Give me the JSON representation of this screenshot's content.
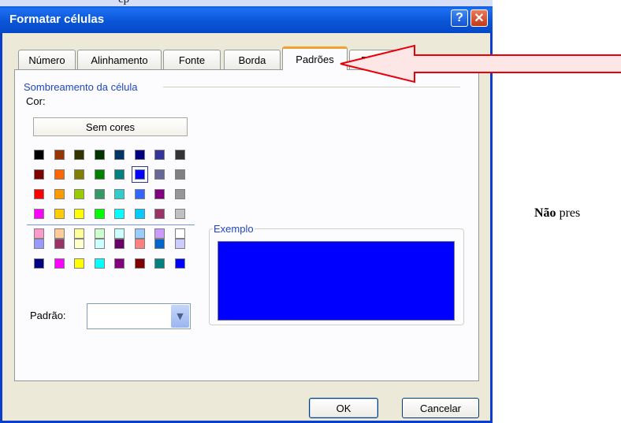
{
  "top_caption": "ep",
  "window": {
    "title": "Formatar células",
    "help_label": "?",
    "close_label": "✕"
  },
  "tabs": [
    {
      "label": "Número",
      "active": false
    },
    {
      "label": "Alinhamento",
      "active": false
    },
    {
      "label": "Fonte",
      "active": false
    },
    {
      "label": "Borda",
      "active": false
    },
    {
      "label": "Padrões",
      "active": true
    },
    {
      "label": "Proteção",
      "active": false
    }
  ],
  "shading": {
    "group_label": "Sombreamento da célula",
    "color_label": "Cor:",
    "no_color_button": "Sem cores",
    "selected_color": "#0000ff",
    "palette_main": [
      [
        "#000000",
        "#993300",
        "#333300",
        "#003300",
        "#003366",
        "#000080",
        "#333399",
        "#333333"
      ],
      [
        "#800000",
        "#ff6600",
        "#808000",
        "#008000",
        "#008080",
        "#0000ff",
        "#666699",
        "#808080"
      ],
      [
        "#ff0000",
        "#ff9900",
        "#99cc00",
        "#339966",
        "#33cccc",
        "#3366ff",
        "#800080",
        "#969696"
      ],
      [
        "#ff00ff",
        "#ffcc00",
        "#ffff00",
        "#00ff00",
        "#00ffff",
        "#00ccff",
        "#993366",
        "#c0c0c0"
      ],
      [
        "#ff99cc",
        "#ffcc99",
        "#ffff99",
        "#ccffcc",
        "#ccffff",
        "#99ccff",
        "#cc99ff",
        "#ffffff"
      ]
    ],
    "palette_extra": [
      [
        "#9999ff",
        "#993366",
        "#ffffcc",
        "#ccffff",
        "#660066",
        "#ff8080",
        "#0066cc",
        "#ccccff"
      ],
      [
        "#000080",
        "#ff00ff",
        "#ffff00",
        "#00ffff",
        "#800080",
        "#800000",
        "#008080",
        "#0000ff"
      ]
    ]
  },
  "example": {
    "label": "Exemplo",
    "color": "#0000ff"
  },
  "pattern": {
    "label": "Padrão:",
    "value": ""
  },
  "buttons": {
    "ok": "OK",
    "cancel": "Cancelar"
  },
  "side_note": {
    "bold": "Não",
    "rest": " pres"
  },
  "colors": {
    "title_bar": "#0a55d8",
    "arrow": "#e8000b",
    "tab_accent": "#f0a12f",
    "group_label": "#1f45c4"
  }
}
